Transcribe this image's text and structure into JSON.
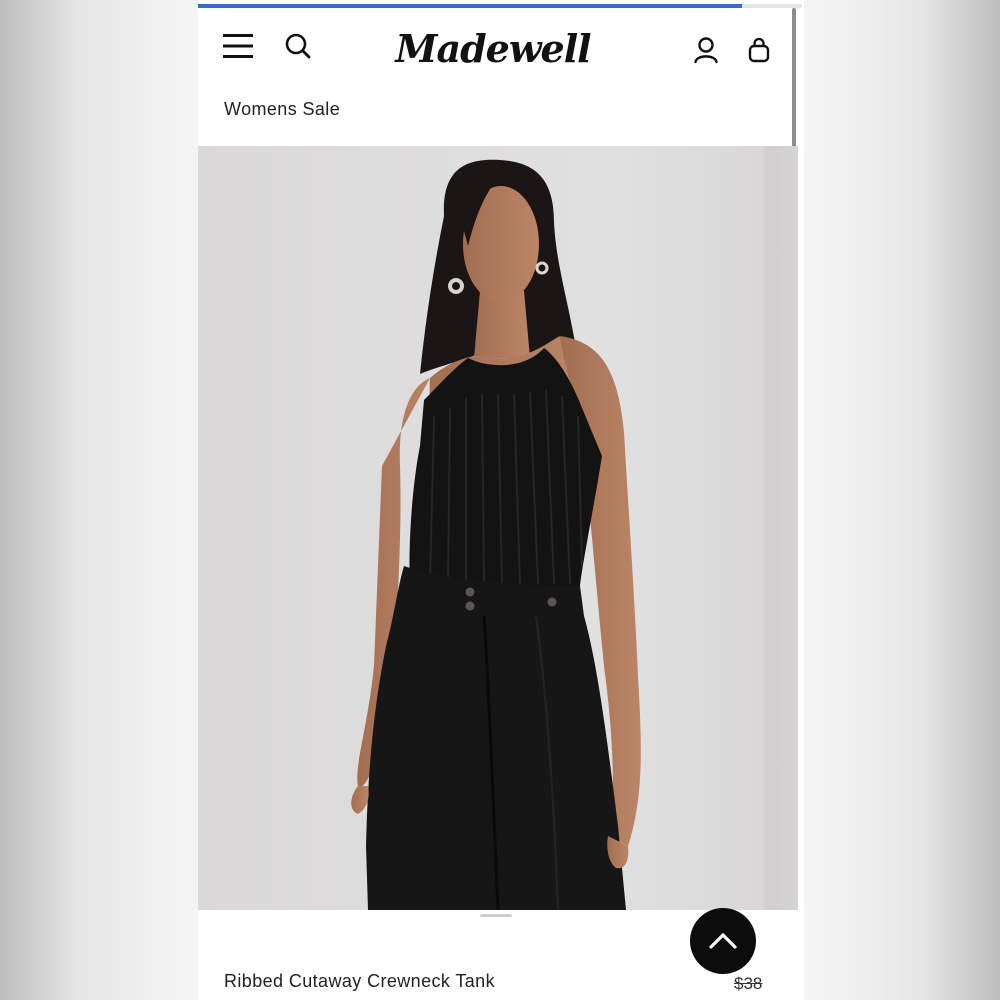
{
  "browser": {
    "load_progress": 0.9
  },
  "header": {
    "brand": "Madewell",
    "icons": {
      "menu": "hamburger-menu-icon",
      "search": "search-icon",
      "account": "user-account-icon",
      "bag": "shopping-bag-icon"
    }
  },
  "breadcrumb": {
    "label": "Womens Sale"
  },
  "product": {
    "name": "Ribbed Cutaway Crewneck Tank",
    "original_price": "$38",
    "image_alt_subject": "model-wearing-black-ribbed-halter-tank-and-black-pleated-trousers"
  },
  "controls": {
    "back_to_top_icon": "chevron-up-icon"
  },
  "colors": {
    "accent": "#2f6fd0",
    "text": "#222222",
    "button_bg": "#0c0c0c",
    "image_bg": "#dedcdd",
    "garment": "#121212"
  }
}
